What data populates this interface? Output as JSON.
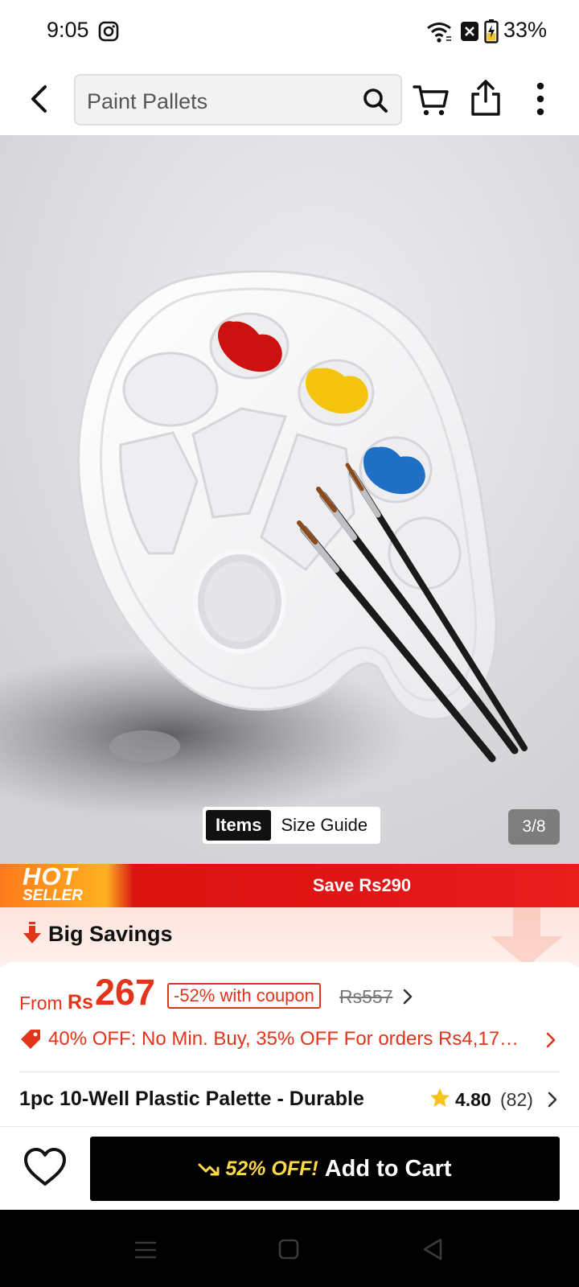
{
  "status_bar": {
    "time": "9:05",
    "battery": "33%",
    "icons": [
      "instagram-icon",
      "wifi-icon",
      "notification-x-icon",
      "battery-charging-icon"
    ]
  },
  "top_bar": {
    "search_value": "Paint Pallets",
    "icons": [
      "back-arrow-icon",
      "search-icon",
      "cart-icon",
      "share-icon",
      "more-vertical-icon"
    ]
  },
  "gallery": {
    "tabs": [
      {
        "label": "Items",
        "active": true
      },
      {
        "label": "Size Guide",
        "active": false
      }
    ],
    "counter": "3/8"
  },
  "promo": {
    "hot": "HOT",
    "seller": "SELLER",
    "save": "Save Rs290",
    "accent": "#e01515"
  },
  "savings": {
    "label": "Big Savings"
  },
  "price": {
    "from": "From",
    "currency": "Rs",
    "value": "267",
    "coupon": "-52% with coupon",
    "old_price": "Rs557",
    "accent": "#e2341b"
  },
  "offer": {
    "text": "40% OFF: No Min. Buy,  35% OFF For orders Rs4,17…"
  },
  "product": {
    "title": "1pc 10-Well Plastic Palette - Durable",
    "rating": "4.80",
    "reviews": "(82)"
  },
  "action": {
    "discount": "52% OFF!",
    "add_to_cart": "Add to Cart"
  }
}
